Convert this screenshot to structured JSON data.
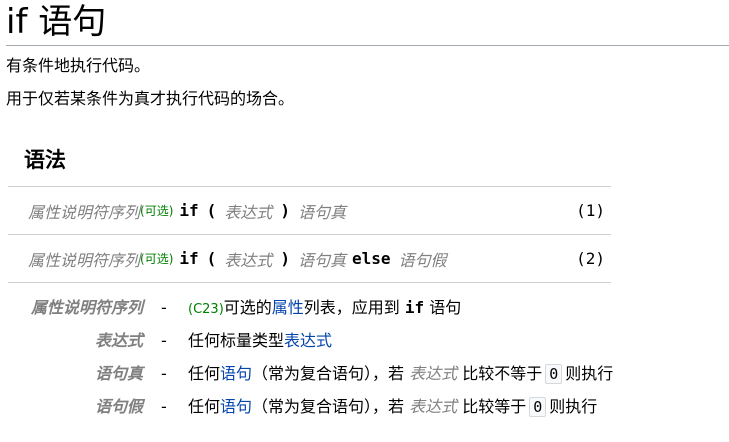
{
  "page": {
    "title": "if 语句",
    "intro_line1": "有条件地执行代码。",
    "intro_line2": "用于仅若某条件为真才执行代码的场合。"
  },
  "syntax": {
    "heading": "语法",
    "rows": [
      {
        "attr": "属性说明符序列",
        "opt": "(可选)",
        "kw_if": "if",
        "lparen": "(",
        "expr": "表达式",
        "rparen": ")",
        "stmt_true": "语句真",
        "kw_else": "",
        "stmt_false": "",
        "num": "(1)"
      },
      {
        "attr": "属性说明符序列",
        "opt": "(可选)",
        "kw_if": "if",
        "lparen": "(",
        "expr": "表达式",
        "rparen": ")",
        "stmt_true": "语句真",
        "kw_else": "else",
        "stmt_false": "语句假",
        "num": "(2)"
      }
    ]
  },
  "params": [
    {
      "name": "属性说明符序列",
      "dash": "-",
      "rev": "(C23)",
      "t1": "可选的",
      "link1": "属性",
      "t2": "列表，应用到",
      "code": "if",
      "t3": "语句"
    },
    {
      "name": "表达式",
      "dash": "-",
      "t1": "任何标量类型",
      "link1": "表达式"
    },
    {
      "name": "语句真",
      "dash": "-",
      "t1": "任何",
      "link1": "语句",
      "t2": "（常为复合语句），若",
      "ph": "表达式",
      "t3": "比较不等于",
      "zero": "0",
      "t4": "则执行"
    },
    {
      "name": "语句假",
      "dash": "-",
      "t1": "任何",
      "link1": "语句",
      "t2": "（常为复合语句），若",
      "ph": "表达式",
      "t3": "比较等于",
      "zero": "0",
      "t4": "则执行"
    }
  ]
}
